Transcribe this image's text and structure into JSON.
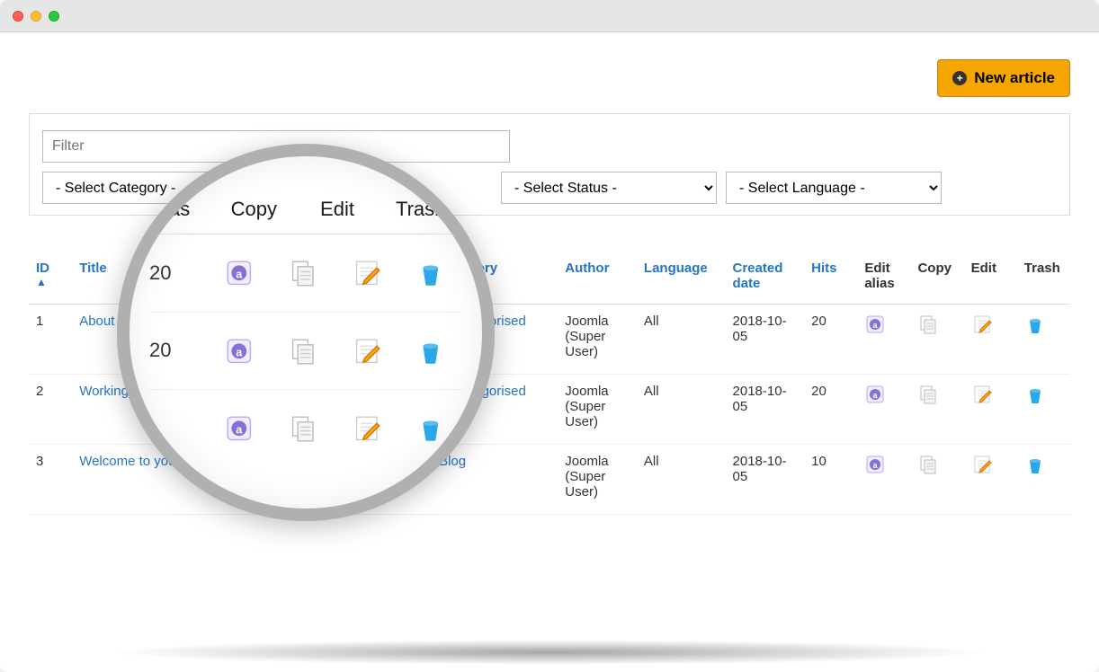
{
  "toolbar": {
    "new_article_label": "New article"
  },
  "filters": {
    "filter_placeholder": "Filter",
    "select_category": "- Select Category -",
    "select_status": "- Select Status -",
    "select_language": "- Select Language -"
  },
  "columns": {
    "id": "ID",
    "title": "Title",
    "category": "Category",
    "author": "Author",
    "language": "Language",
    "created_date": "Created date",
    "hits": "Hits",
    "edit_alias": "Edit alias",
    "copy": "Copy",
    "edit": "Edit",
    "trash": "Trash"
  },
  "sort_glyph": "▲",
  "rows": [
    {
      "id": "1",
      "title": "About",
      "category": "Uncategorised",
      "author": "Joomla (Super User)",
      "language": "All",
      "created": "2018-10-05",
      "hits": "20"
    },
    {
      "id": "2",
      "title": "Working on Your",
      "category": "Uncategorised",
      "author": "Joomla (Super User)",
      "language": "All",
      "created": "2018-10-05",
      "hits": "20"
    },
    {
      "id": "3",
      "title": "Welcome to your blog",
      "category": "Blog",
      "author": "Joomla (Super User)",
      "language": "All",
      "created": "2018-10-05",
      "hits": "10"
    }
  ],
  "lens": {
    "cols": {
      "edit_alias": "Edit\nalias",
      "copy": "Copy",
      "edit": "Edit",
      "trash": "Trash"
    },
    "hits": [
      "20",
      "20"
    ]
  }
}
